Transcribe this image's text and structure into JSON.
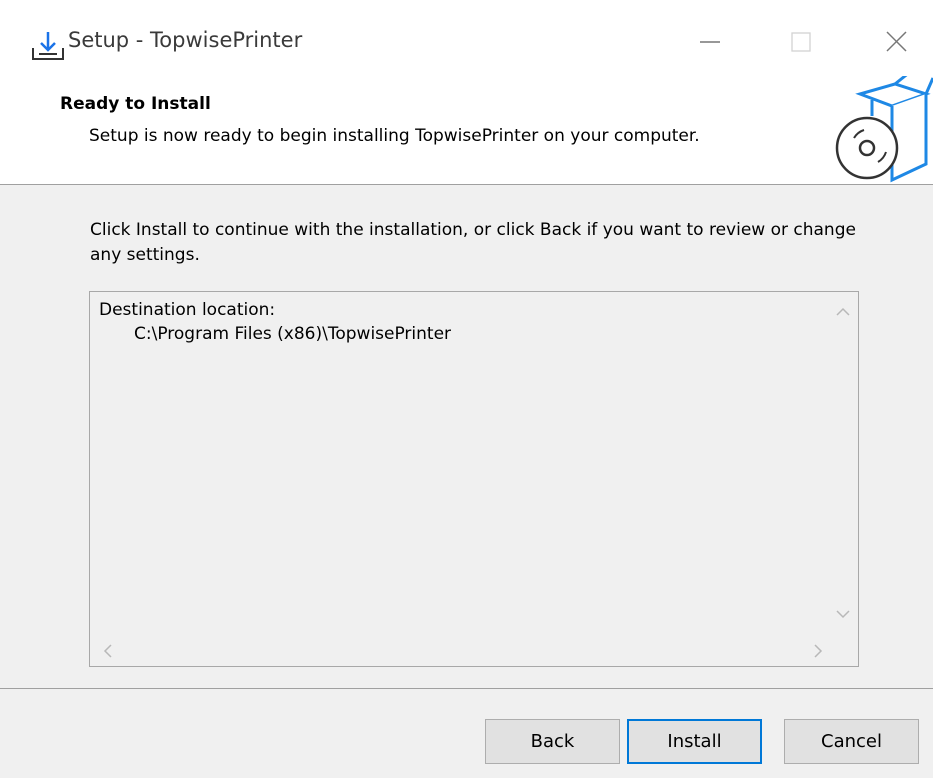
{
  "window": {
    "title": "Setup - TopwisePrinter",
    "icons": [
      "installer-icon",
      "minimize-icon",
      "maximize-icon",
      "close-icon"
    ]
  },
  "header": {
    "title": "Ready to Install",
    "subtitle": "Setup is now ready to begin installing TopwisePrinter on your computer.",
    "image_icon": "box-disc-icon"
  },
  "main": {
    "instructions": "Click Install to continue with the installation, or click Back if you want to review or change any settings.",
    "memo": {
      "label": "Destination location:",
      "value": "C:\\Program Files (x86)\\TopwisePrinter"
    }
  },
  "buttons": {
    "back": "Back",
    "install": "Install",
    "cancel": "Cancel"
  },
  "colors": {
    "accent": "#0078d7",
    "face": "#f0f0f0",
    "button": "#e1e1e1"
  }
}
